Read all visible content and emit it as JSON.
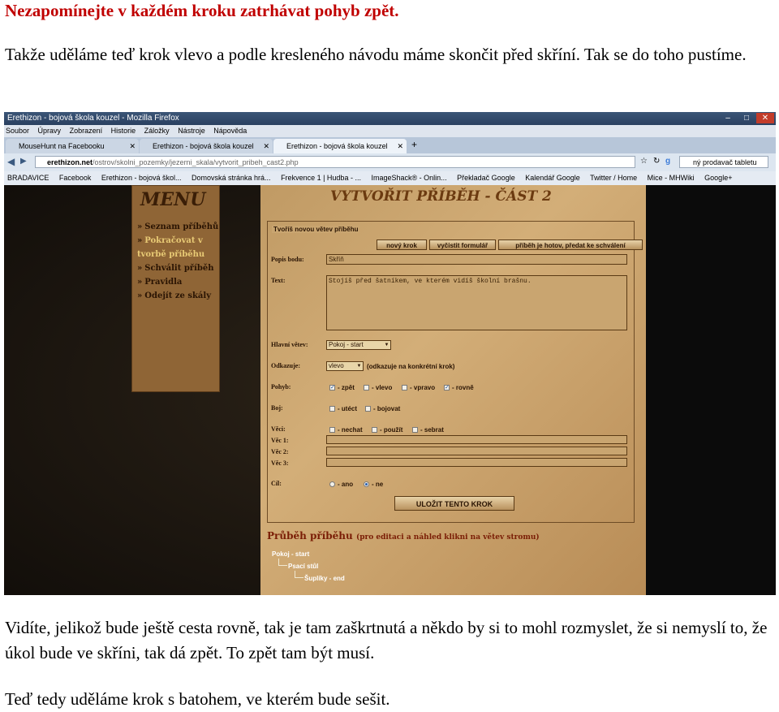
{
  "document": {
    "warning": "Nezapomínejte v každém kroku zatrhávat pohyb zpět.",
    "intro": "Takže uděláme teď krok vlevo a podle kresleného návodu máme skončit před skříní. Tak se do toho pustíme.",
    "after_1": "Vidíte, jelikož bude ještě cesta rovně, tak je tam zaškrtnutá a někdo by si to mohl rozmyslet, že si nemyslí to, že úkol bude ve skříni, tak dá zpět. To zpět tam být musí.",
    "after_2": "Teď tedy uděláme krok s batohem, ve kterém bude sešit."
  },
  "browser": {
    "window_title": "Erethizon - bojová škola kouzel - Mozilla Firefox",
    "menu": [
      "Soubor",
      "Úpravy",
      "Zobrazení",
      "Historie",
      "Záložky",
      "Nástroje",
      "Nápověda"
    ],
    "tabs": [
      {
        "label": "MouseHunt na Facebooku",
        "active": false
      },
      {
        "label": "Erethizon - bojová škola kouzel",
        "active": false
      },
      {
        "label": "Erethizon - bojová škola kouzel",
        "active": true
      }
    ],
    "new_tab": "+",
    "url_domain": "erethizon.net",
    "url_path": "/ostrov/skolni_pozemky/jezerni_skala/vytvorit_pribeh_cast2.php",
    "search_placeholder": "ný prodavač tabletu",
    "bookmarks": [
      "BRADAVICE",
      "Facebook",
      "Erethizon - bojová škol...",
      "Domovská stránka hrá...",
      "Frekvence 1 | Hudba - ...",
      "ImageShack® - Onlin...",
      "Překladač Google",
      "Kalendář Google",
      "Twitter / Home",
      "Mice - MHWiki",
      "Google+"
    ]
  },
  "site": {
    "menu_title": "MENU",
    "menu_items": [
      {
        "label": "Seznam příběhů",
        "active": false
      },
      {
        "label": "Pokračovat v tvorbě příběhu",
        "active": true
      },
      {
        "label": "Schválit příběh",
        "active": false
      },
      {
        "label": "Pravidla",
        "active": false
      },
      {
        "label": "Odejít ze skály",
        "active": false
      }
    ],
    "page_title": "VYTVOŘIT PŘÍBĚH - ČÁST 2",
    "form_legend": "Tvoříš novou větev příběhu",
    "buttons": {
      "new_step": "nový krok",
      "clear_form": "vyčistit formulář",
      "finish": "příběh je hotov, předat ke schválení",
      "save_step": "ULOŽIT TENTO KROK"
    },
    "labels": {
      "popis": "Popis bodu:",
      "text": "Text:",
      "hlavni": "Hlavní větev:",
      "odkazuje": "Odkazuje:",
      "odkazuje_note": "(odkazuje na konkrétní krok)",
      "pohyb": "Pohyb:",
      "boj": "Boj:",
      "veci": "Věci:",
      "vec1": "Věc 1:",
      "vec2": "Věc 2:",
      "vec3": "Věc 3:",
      "cil": "Cíl:"
    },
    "values": {
      "popis": "Skříň",
      "text": "Stojíš před šatníkem, ve kterém vidíš školní brašnu.",
      "hlavni": "Pokoj - start",
      "odkazuje": "vlevo"
    },
    "options": {
      "pohyb": [
        {
          "label": "- zpět",
          "checked": true
        },
        {
          "label": "- vlevo",
          "checked": false
        },
        {
          "label": "- vpravo",
          "checked": false
        },
        {
          "label": "- rovně",
          "checked": true
        }
      ],
      "boj": [
        {
          "label": "- utéct",
          "checked": false
        },
        {
          "label": "- bojovat",
          "checked": false
        }
      ],
      "veci": [
        {
          "label": "- nechat",
          "checked": false
        },
        {
          "label": "- použít",
          "checked": false
        },
        {
          "label": "- sebrat",
          "checked": false
        }
      ],
      "cil": [
        {
          "label": "- ano",
          "checked": false
        },
        {
          "label": "- ne",
          "checked": true
        }
      ]
    },
    "tree_heading": "Průběh příběhu",
    "tree_heading_sub": "(pro editaci a náhled klikni na větev stromu)",
    "tree": [
      "Pokoj - start",
      "Psací stůl",
      "Šuplíky - end"
    ]
  }
}
